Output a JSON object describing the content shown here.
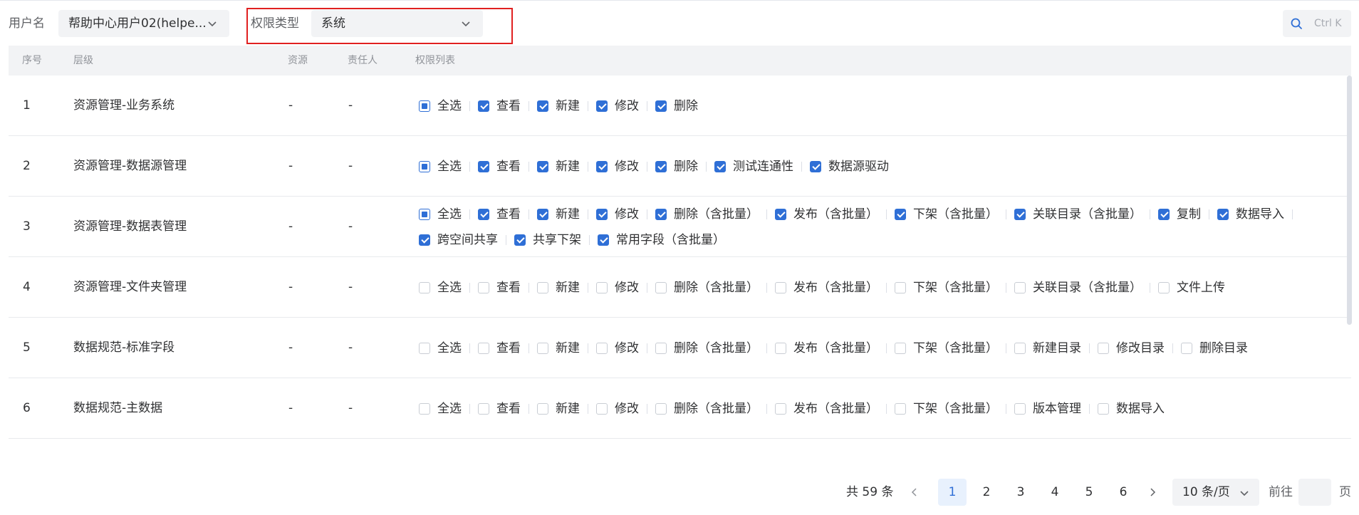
{
  "filters": {
    "username_label": "用户名",
    "username_value": "帮助中心用户02(helpe...",
    "perm_type_label": "权限类型",
    "perm_type_value": "系统",
    "search_shortcut": "Ctrl K"
  },
  "table": {
    "columns": {
      "index": "序号",
      "level": "层级",
      "resource": "资源",
      "owner": "责任人",
      "perms": "权限列表"
    },
    "rows": [
      {
        "index": "1",
        "level": "资源管理-业务系统",
        "resource": "-",
        "owner": "-",
        "lines": [
          [
            {
              "label": "全选",
              "state": "indeterminate"
            },
            {
              "label": "查看",
              "state": "checked"
            },
            {
              "label": "新建",
              "state": "checked"
            },
            {
              "label": "修改",
              "state": "checked"
            },
            {
              "label": "删除",
              "state": "checked"
            }
          ]
        ]
      },
      {
        "index": "2",
        "level": "资源管理-数据源管理",
        "resource": "-",
        "owner": "-",
        "lines": [
          [
            {
              "label": "全选",
              "state": "indeterminate"
            },
            {
              "label": "查看",
              "state": "checked"
            },
            {
              "label": "新建",
              "state": "checked"
            },
            {
              "label": "修改",
              "state": "checked"
            },
            {
              "label": "删除",
              "state": "checked"
            },
            {
              "label": "测试连通性",
              "state": "checked"
            },
            {
              "label": "数据源驱动",
              "state": "checked"
            }
          ]
        ]
      },
      {
        "index": "3",
        "level": "资源管理-数据表管理",
        "resource": "-",
        "owner": "-",
        "lines": [
          [
            {
              "label": "全选",
              "state": "indeterminate"
            },
            {
              "label": "查看",
              "state": "checked"
            },
            {
              "label": "新建",
              "state": "checked"
            },
            {
              "label": "修改",
              "state": "checked"
            },
            {
              "label": "删除（含批量）",
              "state": "checked"
            },
            {
              "label": "发布（含批量）",
              "state": "checked"
            },
            {
              "label": "下架（含批量）",
              "state": "checked"
            },
            {
              "label": "关联目录（含批量）",
              "state": "checked"
            },
            {
              "label": "复制",
              "state": "checked"
            },
            {
              "label": "数据导入",
              "state": "checked"
            }
          ],
          [
            {
              "label": "跨空间共享",
              "state": "checked"
            },
            {
              "label": "共享下架",
              "state": "checked"
            },
            {
              "label": "常用字段（含批量）",
              "state": "checked"
            }
          ]
        ]
      },
      {
        "index": "4",
        "level": "资源管理-文件夹管理",
        "resource": "-",
        "owner": "-",
        "lines": [
          [
            {
              "label": "全选",
              "state": "unchecked"
            },
            {
              "label": "查看",
              "state": "unchecked"
            },
            {
              "label": "新建",
              "state": "unchecked"
            },
            {
              "label": "修改",
              "state": "unchecked"
            },
            {
              "label": "删除（含批量）",
              "state": "unchecked"
            },
            {
              "label": "发布（含批量）",
              "state": "unchecked"
            },
            {
              "label": "下架（含批量）",
              "state": "unchecked"
            },
            {
              "label": "关联目录（含批量）",
              "state": "unchecked"
            },
            {
              "label": "文件上传",
              "state": "unchecked"
            }
          ]
        ]
      },
      {
        "index": "5",
        "level": "数据规范-标准字段",
        "resource": "-",
        "owner": "-",
        "lines": [
          [
            {
              "label": "全选",
              "state": "unchecked"
            },
            {
              "label": "查看",
              "state": "unchecked"
            },
            {
              "label": "新建",
              "state": "unchecked"
            },
            {
              "label": "修改",
              "state": "unchecked"
            },
            {
              "label": "删除（含批量）",
              "state": "unchecked"
            },
            {
              "label": "发布（含批量）",
              "state": "unchecked"
            },
            {
              "label": "下架（含批量）",
              "state": "unchecked"
            },
            {
              "label": "新建目录",
              "state": "unchecked"
            },
            {
              "label": "修改目录",
              "state": "unchecked"
            },
            {
              "label": "删除目录",
              "state": "unchecked"
            }
          ]
        ]
      },
      {
        "index": "6",
        "level": "数据规范-主数据",
        "resource": "-",
        "owner": "-",
        "lines": [
          [
            {
              "label": "全选",
              "state": "unchecked"
            },
            {
              "label": "查看",
              "state": "unchecked"
            },
            {
              "label": "新建",
              "state": "unchecked"
            },
            {
              "label": "修改",
              "state": "unchecked"
            },
            {
              "label": "删除（含批量）",
              "state": "unchecked"
            },
            {
              "label": "发布（含批量）",
              "state": "unchecked"
            },
            {
              "label": "下架（含批量）",
              "state": "unchecked"
            },
            {
              "label": "版本管理",
              "state": "unchecked"
            },
            {
              "label": "数据导入",
              "state": "unchecked"
            }
          ]
        ]
      }
    ]
  },
  "pagination": {
    "total": "共 59 条",
    "pages": [
      "1",
      "2",
      "3",
      "4",
      "5",
      "6"
    ],
    "current": "1",
    "page_size": "10 条/页",
    "goto_label": "前往",
    "page_suffix": "页"
  },
  "colors": {
    "accent": "#2f6fd6",
    "highlight": "#e02020",
    "header_bg": "#f2f3f5"
  }
}
